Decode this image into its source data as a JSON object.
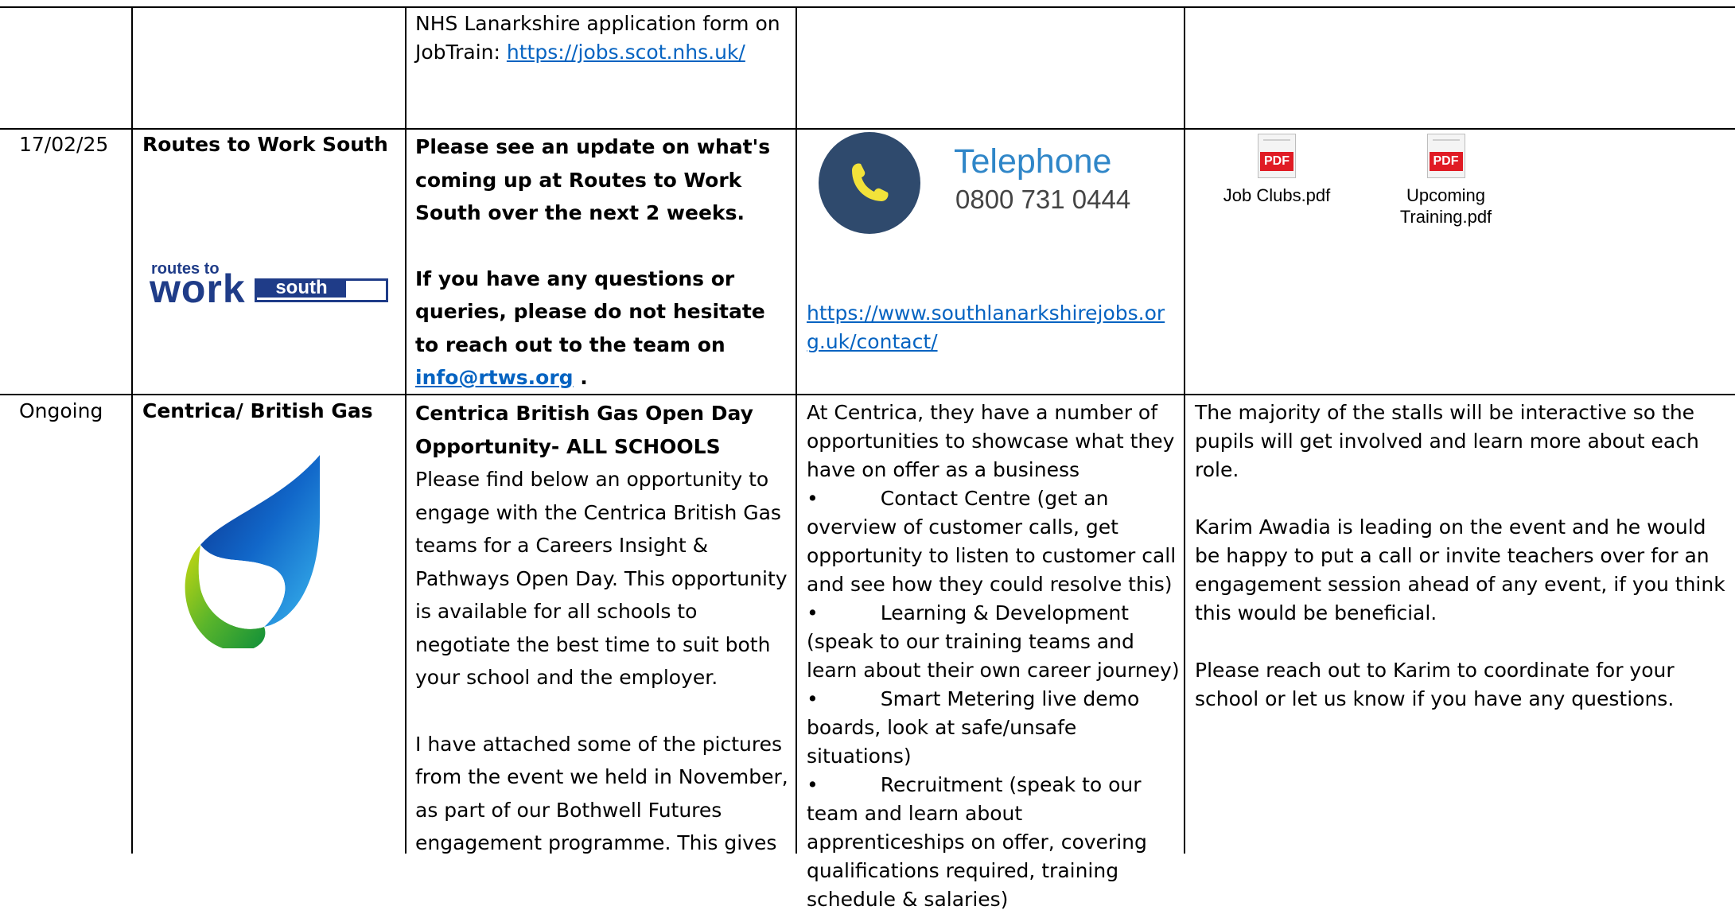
{
  "row0": {
    "col3_text": "NHS Lanarkshire application form on JobTrain: ",
    "col3_link": "https://jobs.scot.nhs.uk/"
  },
  "row1": {
    "date": "17/02/25",
    "org": "Routes to Work South",
    "logo": {
      "line1": "routes to",
      "line2": "work",
      "line3": "south",
      "color": "#1f3c88"
    },
    "desc_p1": "Please see an update on what's coming up at Routes to Work South over the next 2 weeks.",
    "desc_p2_pre": "If you have any questions or queries, please do not hesitate to reach out to the team on ",
    "desc_p2_email": "info@rtws.org",
    "desc_p2_post": " .",
    "contact": {
      "label": "Telephone",
      "number": "0800 731 0444",
      "icon": "phone-icon",
      "circle_color": "#2f4a6d",
      "handset_color": "#f2e23a"
    },
    "contact_link_line1": "https://www.southlanarkshirejobs.or",
    "contact_link_line2": "g.uk/contact/",
    "attachments": [
      {
        "name": "Job Clubs.pdf",
        "icon": "pdf-icon",
        "tag": "PDF"
      },
      {
        "name_line1": "Upcoming",
        "name_line2": "Training.pdf",
        "icon": "pdf-icon",
        "tag": "PDF"
      }
    ]
  },
  "row2": {
    "date": "Ongoing",
    "org": "Centrica/ British Gas",
    "desc_title": "Centrica British Gas Open Day Opportunity- ALL SCHOOLS",
    "desc_p1": "Please find below an opportunity to engage with the Centrica British Gas teams for a Careers Insight & Pathways Open Day. This opportunity is available for all schools to negotiate the best time to suit both your school and the employer.",
    "desc_p2": "I have attached some of the pictures from the event we held in November, as part of our Bothwell Futures engagement programme. This gives",
    "info_intro": "At Centrica, they have a number of opportunities to showcase what they have on offer as a business",
    "info_bullets": [
      {
        "head": "Contact Centre (get an",
        "rest": "overview of customer calls, get opportunity to listen to customer call and see how they could resolve this)"
      },
      {
        "head": "Learning & Development",
        "rest": "(speak to our training teams and learn about their own career journey)"
      },
      {
        "head": "Smart Metering live demo",
        "rest": "boards, look at safe/unsafe situations)"
      },
      {
        "head": "Recruitment (speak to our",
        "rest": "team and learn about apprenticeships on offer, covering qualifications required, training schedule & salaries)"
      }
    ],
    "bullet": "•",
    "notes_p1": "The majority of the stalls will be interactive so the pupils will get involved and learn more about each role.",
    "notes_p2": "Karim Awadia is leading on the event and he would be happy to put a call or invite teachers over for an engagement session ahead of any event, if you think this would be beneficial.",
    "notes_p3": "Please reach out to Karim to coordinate for your school or let us know if you have any questions."
  }
}
